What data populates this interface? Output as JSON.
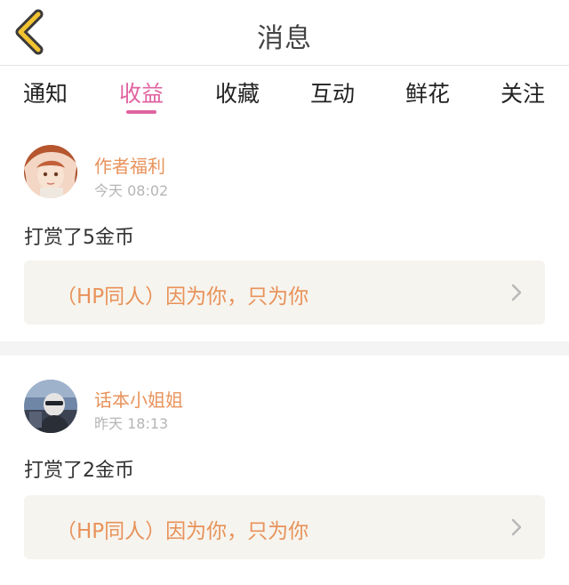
{
  "header": {
    "title": "消息",
    "back_icon": "chevron-left-icon",
    "accent": "#f2c230"
  },
  "tabs": [
    {
      "label": "通知",
      "active": false
    },
    {
      "label": "收益",
      "active": true
    },
    {
      "label": "收藏",
      "active": false
    },
    {
      "label": "互动",
      "active": false
    },
    {
      "label": "鲜花",
      "active": false
    },
    {
      "label": "关注",
      "active": false
    }
  ],
  "colors": {
    "active_tab": "#e063a0",
    "sender": "#e8925a",
    "reference_bg": "#f6f4ee"
  },
  "messages": [
    {
      "sender": "作者福利",
      "time": "今天 08:02",
      "text": "打赏了5金币",
      "reference": "（HP同人）因为你，只为你",
      "avatar": "avatar-anime-girl"
    },
    {
      "sender": "话本小姐姐",
      "time": "昨天 18:13",
      "text": "打赏了2金币",
      "reference": "（HP同人）因为你，只为你",
      "avatar": "avatar-photo"
    }
  ]
}
